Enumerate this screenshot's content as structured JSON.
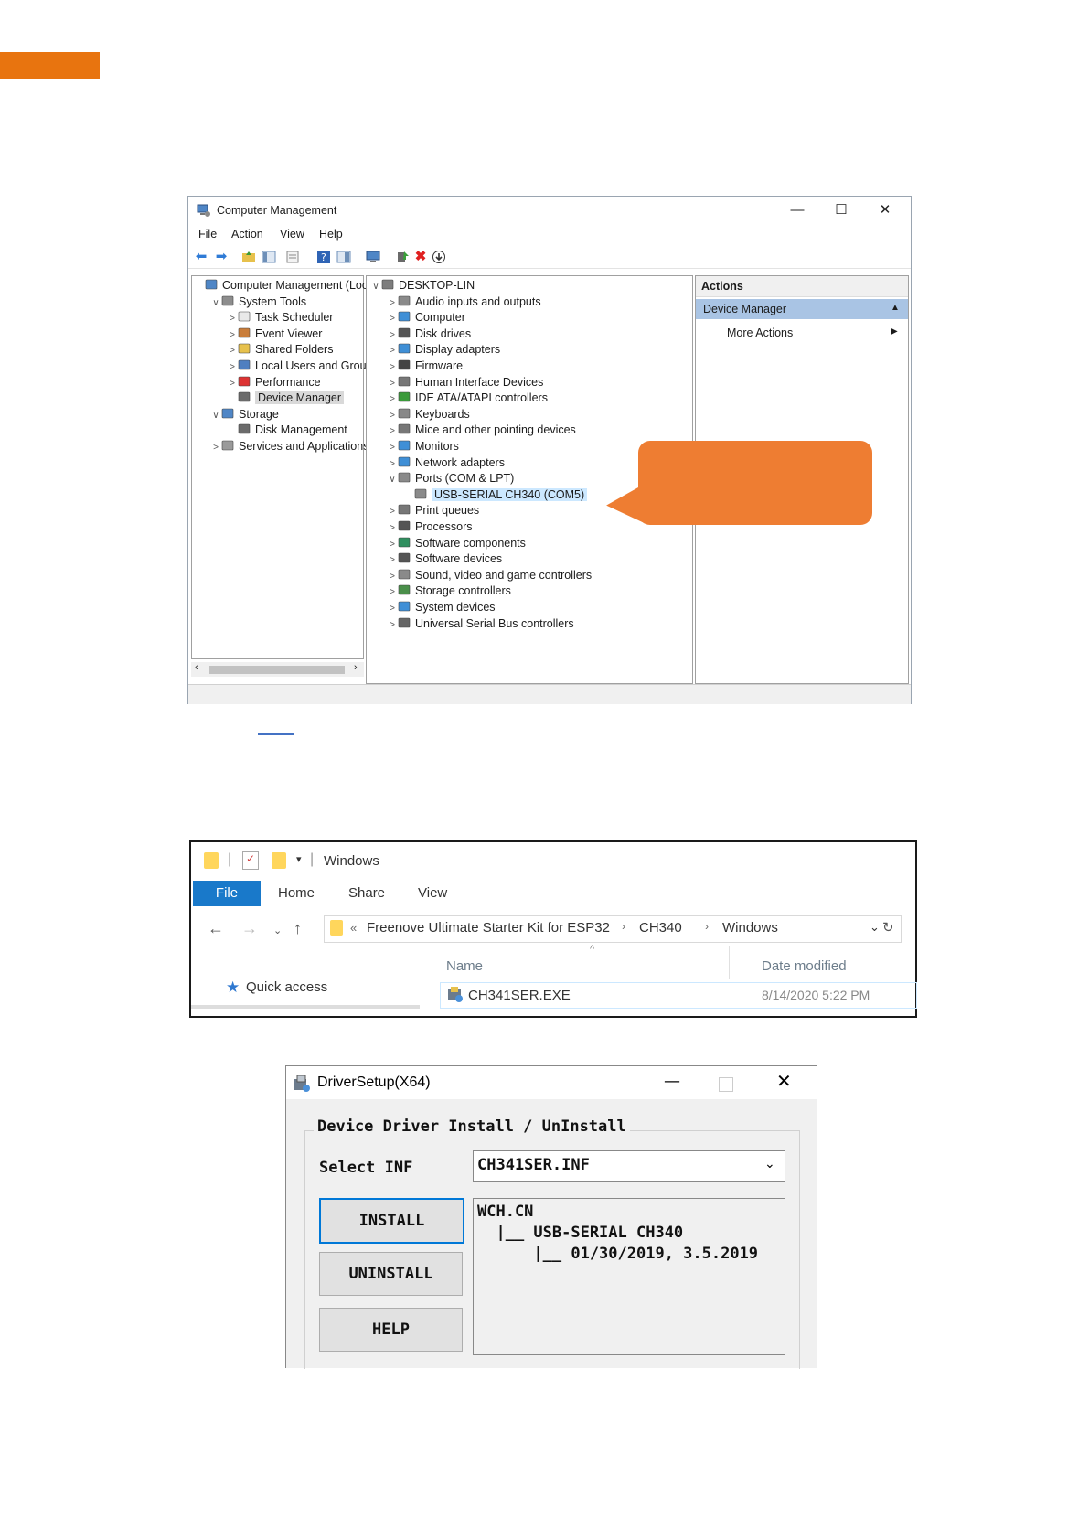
{
  "computer_management": {
    "title": "Computer Management",
    "window_buttons": {
      "minimize": "—",
      "maximize": "☐",
      "close": "✕"
    },
    "menu": [
      "File",
      "Action",
      "View",
      "Help"
    ],
    "left_tree": [
      {
        "label": "Computer Management (Local",
        "indent": 0,
        "chevron": "",
        "icon": "computer-management-icon"
      },
      {
        "label": "System Tools",
        "indent": 1,
        "chevron": "∨",
        "icon": "system-tools-icon"
      },
      {
        "label": "Task Scheduler",
        "indent": 2,
        "chevron": ">",
        "icon": "clock-icon"
      },
      {
        "label": "Event Viewer",
        "indent": 2,
        "chevron": ">",
        "icon": "event-viewer-icon"
      },
      {
        "label": "Shared Folders",
        "indent": 2,
        "chevron": ">",
        "icon": "shared-folder-icon"
      },
      {
        "label": "Local Users and Groups",
        "indent": 2,
        "chevron": ">",
        "icon": "users-icon"
      },
      {
        "label": "Performance",
        "indent": 2,
        "chevron": ">",
        "icon": "performance-icon"
      },
      {
        "label": "Device Manager",
        "indent": 2,
        "chevron": "",
        "icon": "device-manager-icon",
        "selected": true
      },
      {
        "label": "Storage",
        "indent": 1,
        "chevron": "∨",
        "icon": "storage-icon"
      },
      {
        "label": "Disk Management",
        "indent": 2,
        "chevron": "",
        "icon": "disk-icon"
      },
      {
        "label": "Services and Applications",
        "indent": 1,
        "chevron": ">",
        "icon": "services-icon"
      }
    ],
    "device_tree": [
      {
        "label": "DESKTOP-LIN",
        "chevron": "∨",
        "icon": "computer-icon",
        "indent": 0
      },
      {
        "label": "Audio inputs and outputs",
        "chevron": ">",
        "icon": "speaker-icon",
        "indent": 1
      },
      {
        "label": "Computer",
        "chevron": ">",
        "icon": "monitor-icon",
        "indent": 1
      },
      {
        "label": "Disk drives",
        "chevron": ">",
        "icon": "disk-drive-icon",
        "indent": 1
      },
      {
        "label": "Display adapters",
        "chevron": ">",
        "icon": "display-adapter-icon",
        "indent": 1
      },
      {
        "label": "Firmware",
        "chevron": ">",
        "icon": "firmware-icon",
        "indent": 1
      },
      {
        "label": "Human Interface Devices",
        "chevron": ">",
        "icon": "hid-icon",
        "indent": 1
      },
      {
        "label": "IDE ATA/ATAPI controllers",
        "chevron": ">",
        "icon": "ide-controller-icon",
        "indent": 1
      },
      {
        "label": "Keyboards",
        "chevron": ">",
        "icon": "keyboard-icon",
        "indent": 1
      },
      {
        "label": "Mice and other pointing devices",
        "chevron": ">",
        "icon": "mouse-icon",
        "indent": 1
      },
      {
        "label": "Monitors",
        "chevron": ">",
        "icon": "monitor-icon",
        "indent": 1
      },
      {
        "label": "Network adapters",
        "chevron": ">",
        "icon": "network-adapter-icon",
        "indent": 1
      },
      {
        "label": "Ports (COM & LPT)",
        "chevron": "∨",
        "icon": "port-icon",
        "indent": 1
      },
      {
        "label": "USB-SERIAL CH340 (COM5)",
        "chevron": "",
        "icon": "usb-serial-icon",
        "indent": 2,
        "selected": true
      },
      {
        "label": "Print queues",
        "chevron": ">",
        "icon": "printer-icon",
        "indent": 1
      },
      {
        "label": "Processors",
        "chevron": ">",
        "icon": "processor-icon",
        "indent": 1
      },
      {
        "label": "Software components",
        "chevron": ">",
        "icon": "software-component-icon",
        "indent": 1
      },
      {
        "label": "Software devices",
        "chevron": ">",
        "icon": "software-device-icon",
        "indent": 1
      },
      {
        "label": "Sound, video and game controllers",
        "chevron": ">",
        "icon": "sound-icon",
        "indent": 1
      },
      {
        "label": "Storage controllers",
        "chevron": ">",
        "icon": "storage-controller-icon",
        "indent": 1
      },
      {
        "label": "System devices",
        "chevron": ">",
        "icon": "system-device-icon",
        "indent": 1
      },
      {
        "label": "Universal Serial Bus controllers",
        "chevron": ">",
        "icon": "usb-icon",
        "indent": 1
      }
    ],
    "actions": {
      "header": "Actions",
      "section": "Device Manager",
      "more": "More Actions"
    }
  },
  "explorer": {
    "title": "Windows",
    "tabs": [
      "File",
      "Home",
      "Share",
      "View"
    ],
    "breadcrumb": [
      "Freenove Ultimate Starter Kit for ESP32",
      "CH340",
      "Windows"
    ],
    "breadcrumb_prefix": "«",
    "quick_access": "Quick access",
    "columns": {
      "name": "Name",
      "date": "Date modified"
    },
    "file": {
      "name": "CH341SER.EXE",
      "date": "8/14/2020 5:22 PM"
    }
  },
  "driver_setup": {
    "title": "DriverSetup(X64)",
    "group_label": "Device Driver Install / UnInstall",
    "select_label": "Select INF",
    "select_value": "CH341SER.INF",
    "buttons": [
      "INSTALL",
      "UNINSTALL",
      "HELP"
    ],
    "info_lines": [
      "WCH.CN",
      "  |__ USB-SERIAL CH340",
      "      |__ 01/30/2019, 3.5.2019"
    ]
  },
  "colors": {
    "accent_orange": "#e8740f",
    "callout_orange": "#ee7d32",
    "explorer_file_tab": "#1979ca",
    "selection_blue": "#cce8ff"
  }
}
